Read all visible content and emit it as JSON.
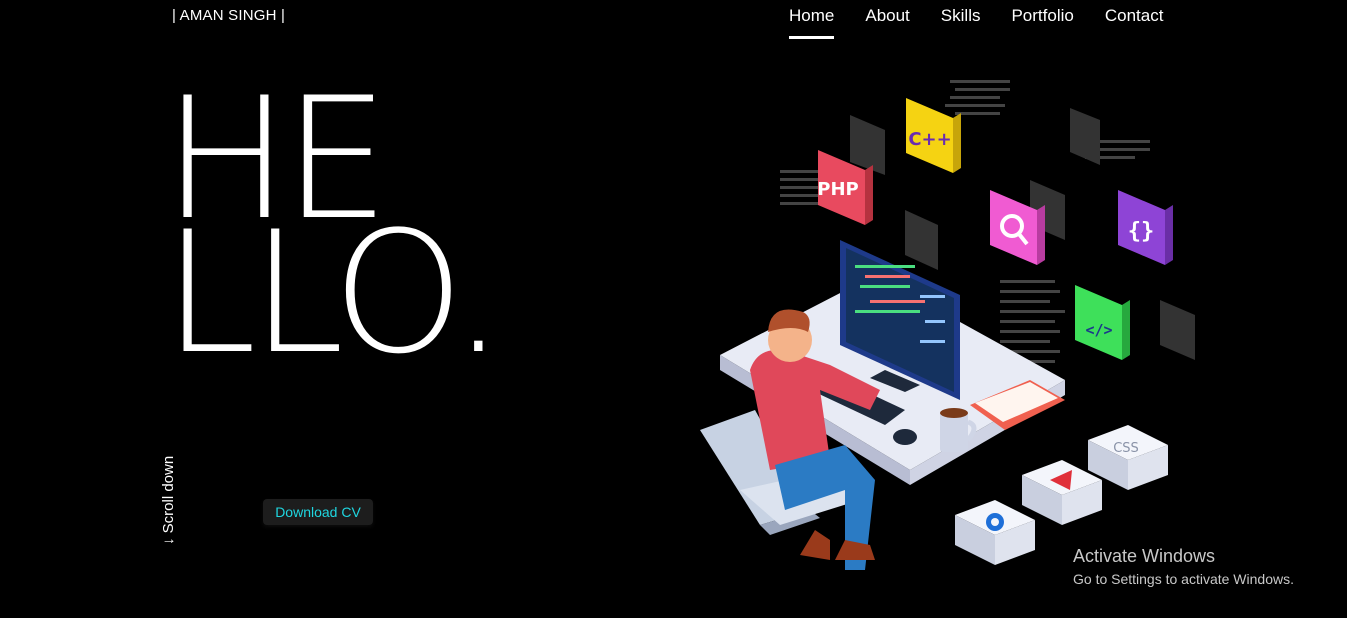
{
  "header": {
    "brand": "| AMAN SINGH |"
  },
  "nav": {
    "items": [
      "Home",
      "About",
      "Skills",
      "Portfolio",
      "Contact"
    ],
    "active": "Home"
  },
  "hero": {
    "line1": "HE",
    "line2": "LLO",
    "dot": "."
  },
  "scroll": {
    "label": "↓ Scroll down"
  },
  "cv": {
    "label": "Download CV"
  },
  "illustration": {
    "badges": [
      "PHP",
      "C++",
      "</>",
      "{}",
      "CSS"
    ]
  },
  "watermark": {
    "title": "Activate Windows",
    "subtitle": "Go to Settings to activate Windows."
  }
}
